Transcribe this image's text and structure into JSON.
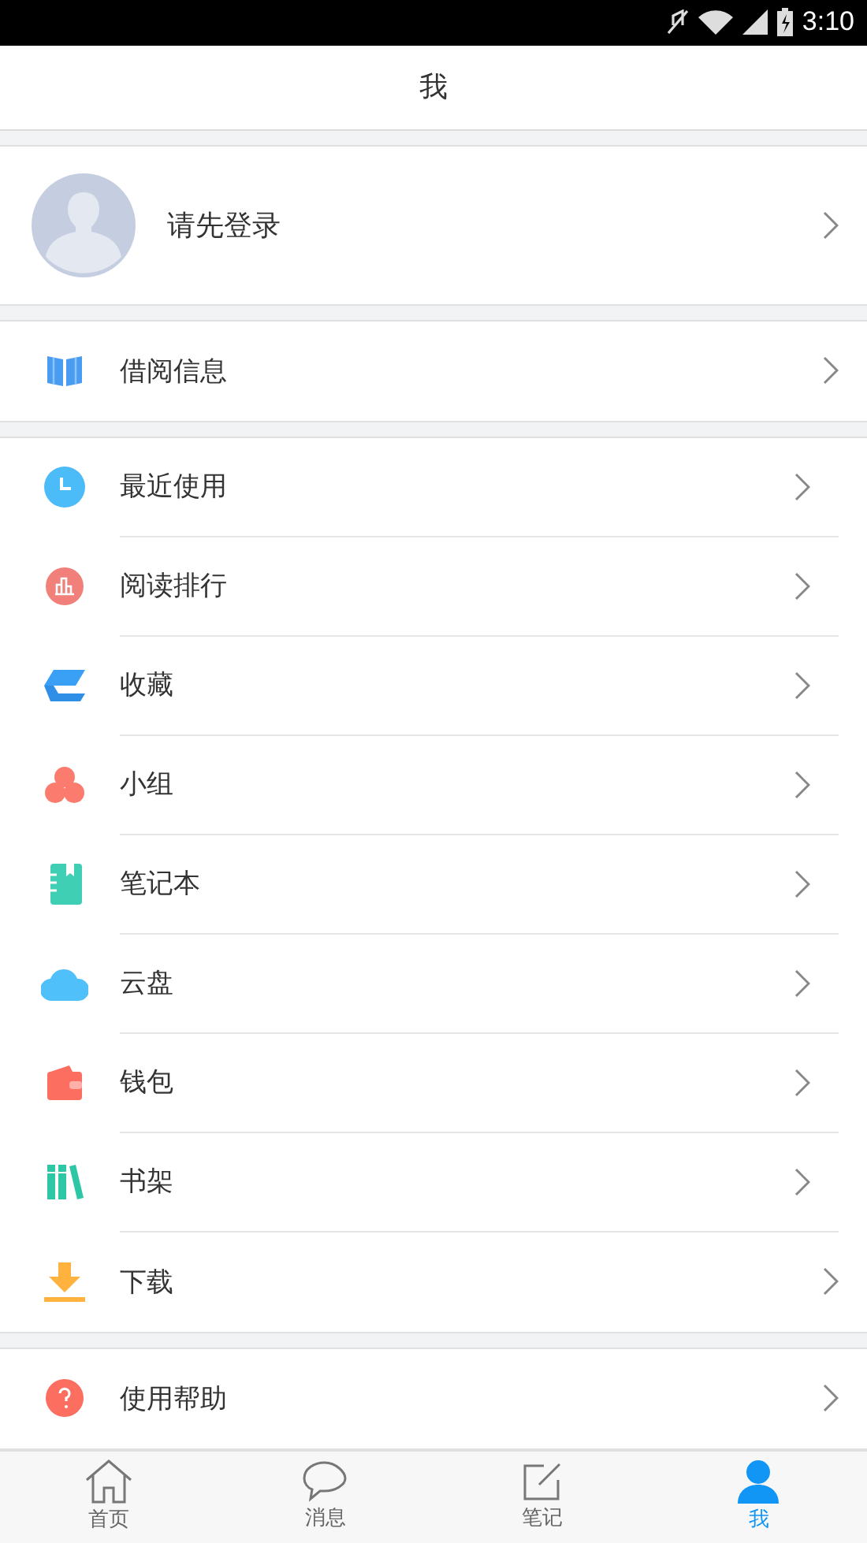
{
  "status_bar": {
    "time": "3:10"
  },
  "header": {
    "title": "我"
  },
  "profile": {
    "label": "请先登录"
  },
  "sections": [
    {
      "items": [
        {
          "kind": "book",
          "label": "借阅信息"
        }
      ]
    },
    {
      "items": [
        {
          "kind": "clock",
          "label": "最近使用"
        },
        {
          "kind": "chart",
          "label": "阅读排行"
        },
        {
          "kind": "layers",
          "label": "收藏"
        },
        {
          "kind": "group",
          "label": "小组"
        },
        {
          "kind": "notebook",
          "label": "笔记本"
        },
        {
          "kind": "cloud",
          "label": "云盘"
        },
        {
          "kind": "wallet",
          "label": "钱包"
        },
        {
          "kind": "shelf",
          "label": "书架"
        },
        {
          "kind": "download",
          "label": "下载"
        }
      ]
    },
    {
      "items": [
        {
          "kind": "help",
          "label": "使用帮助"
        }
      ]
    }
  ],
  "tabs": [
    {
      "kind": "home",
      "label": "首页",
      "selected": false
    },
    {
      "kind": "chat",
      "label": "消息",
      "selected": false
    },
    {
      "kind": "note",
      "label": "笔记",
      "selected": false
    },
    {
      "kind": "user",
      "label": "我",
      "selected": true
    }
  ]
}
